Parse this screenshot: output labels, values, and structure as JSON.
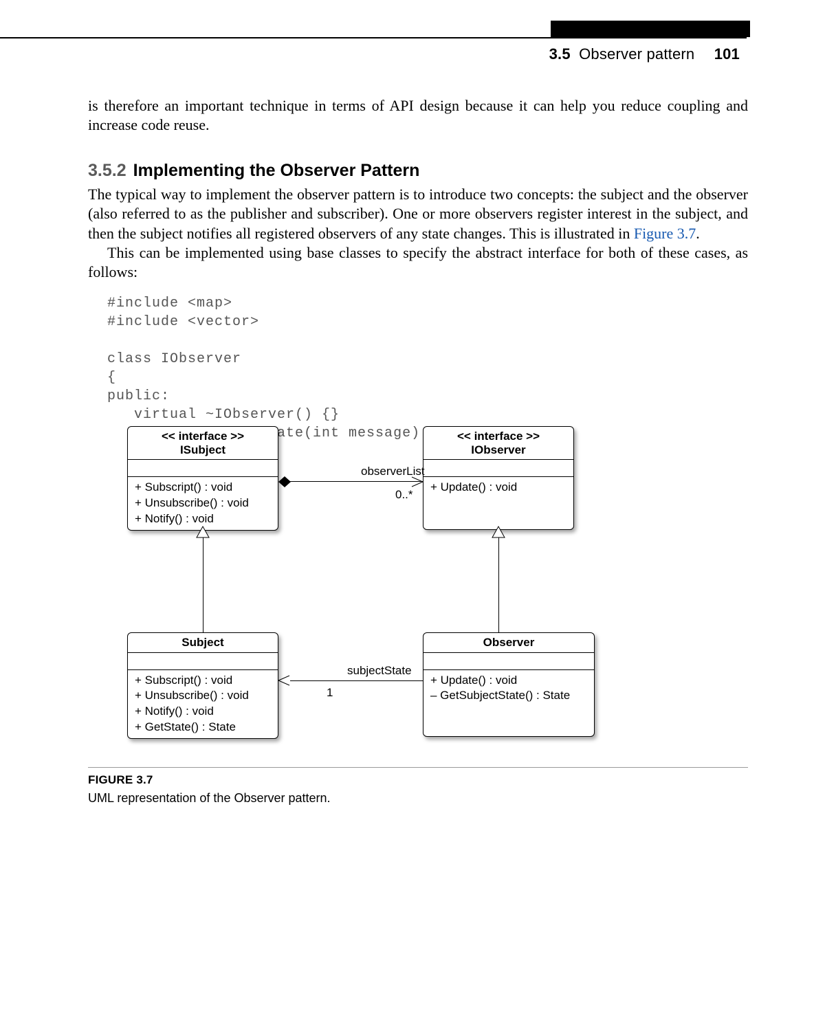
{
  "header": {
    "section_number": "3.5",
    "section_title": "Observer pattern",
    "page_number": "101"
  },
  "intro_para": "is therefore an important technique in terms of API design because it can help you reduce coupling and increase code reuse.",
  "subsection": {
    "number": "3.5.2",
    "title": "Implementing the Observer Pattern"
  },
  "para1_a": "The typical way to implement the observer pattern is to introduce two concepts: the subject and the observer (also referred to as the publisher and subscriber). One or more observers register interest in the subject, and then the subject notifies all registered observers of any state changes. This is illustrated in ",
  "figref": "Figure 3.7",
  "para1_b": ".",
  "para2": "This can be implemented using base classes to specify the abstract interface for both of these cases, as follows:",
  "code": "#include <map>\n#include <vector>\n\nclass IObserver\n{\npublic:\n   virtual ~IObserver() {}\n   virtual void Update(int message) = 0;",
  "uml": {
    "isubject": {
      "stereotype": "<< interface >>",
      "name": "ISubject",
      "ops": [
        "+ Subscript() : void",
        "+ Unsubscribe() : void",
        "+ Notify() : void"
      ]
    },
    "iobserver": {
      "stereotype": "<< interface >>",
      "name": "IObserver",
      "ops": [
        "+ Update() : void"
      ]
    },
    "subject": {
      "name": "Subject",
      "ops": [
        "+ Subscript() : void",
        "+ Unsubscribe() : void",
        "+ Notify() : void",
        "+ GetState() : State"
      ]
    },
    "observer": {
      "name": "Observer",
      "ops": [
        "+ Update() : void",
        "– GetSubjectState() : State"
      ]
    },
    "assoc_top": {
      "role": "observerList",
      "mult": "0..*"
    },
    "assoc_bottom": {
      "role": "subjectState",
      "mult": "1"
    }
  },
  "figure": {
    "label": "FIGURE 3.7",
    "caption": "UML representation of the Observer pattern."
  }
}
